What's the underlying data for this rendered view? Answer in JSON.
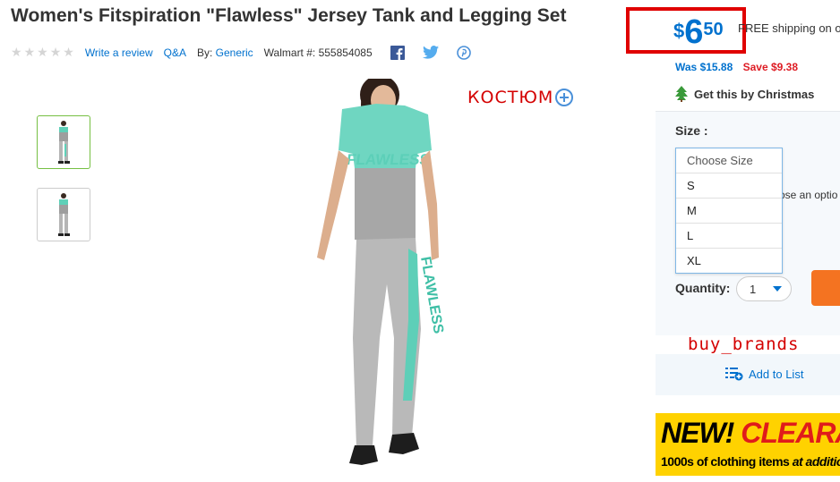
{
  "product": {
    "title": "Women's Fitspiration \"Flawless\" Jersey Tank and Legging Set",
    "write_review": "Write a review",
    "qa": "Q&A",
    "by_label": "By:",
    "brand": "Generic",
    "walmart_label": "Walmart #:",
    "walmart_number": "555854085",
    "rating_stars": 0
  },
  "social": {
    "icons": [
      "facebook-icon",
      "twitter-icon",
      "pinterest-icon"
    ]
  },
  "overlay": {
    "russian_label": "КОСТЮМ",
    "brand_watermark": "buy_brands"
  },
  "price": {
    "currency": "$",
    "dollars": "6",
    "cents": "50",
    "free_shipping": "FREE shipping on o",
    "was": "Was $15.88",
    "save": "Save $9.38",
    "christmas": "Get this by Christmas"
  },
  "size": {
    "label": "Size",
    "colon": ":",
    "hint": "ose an optio",
    "options": [
      "Choose Size",
      "S",
      "M",
      "L",
      "XL"
    ]
  },
  "quantity": {
    "label": "Quantity:",
    "value": "1"
  },
  "actions": {
    "add_to_list": "Add to List"
  },
  "banner": {
    "new": "NEW!",
    "clearance": "CLEARAN",
    "sub_a": "1000s of clothing items",
    "sub_b": "at additio"
  },
  "colors": {
    "accent_blue": "#0071ce",
    "save_red": "#de1c24",
    "overlay_red": "#d40000",
    "banner_yellow": "#ffd200",
    "cart_orange": "#f47321"
  }
}
